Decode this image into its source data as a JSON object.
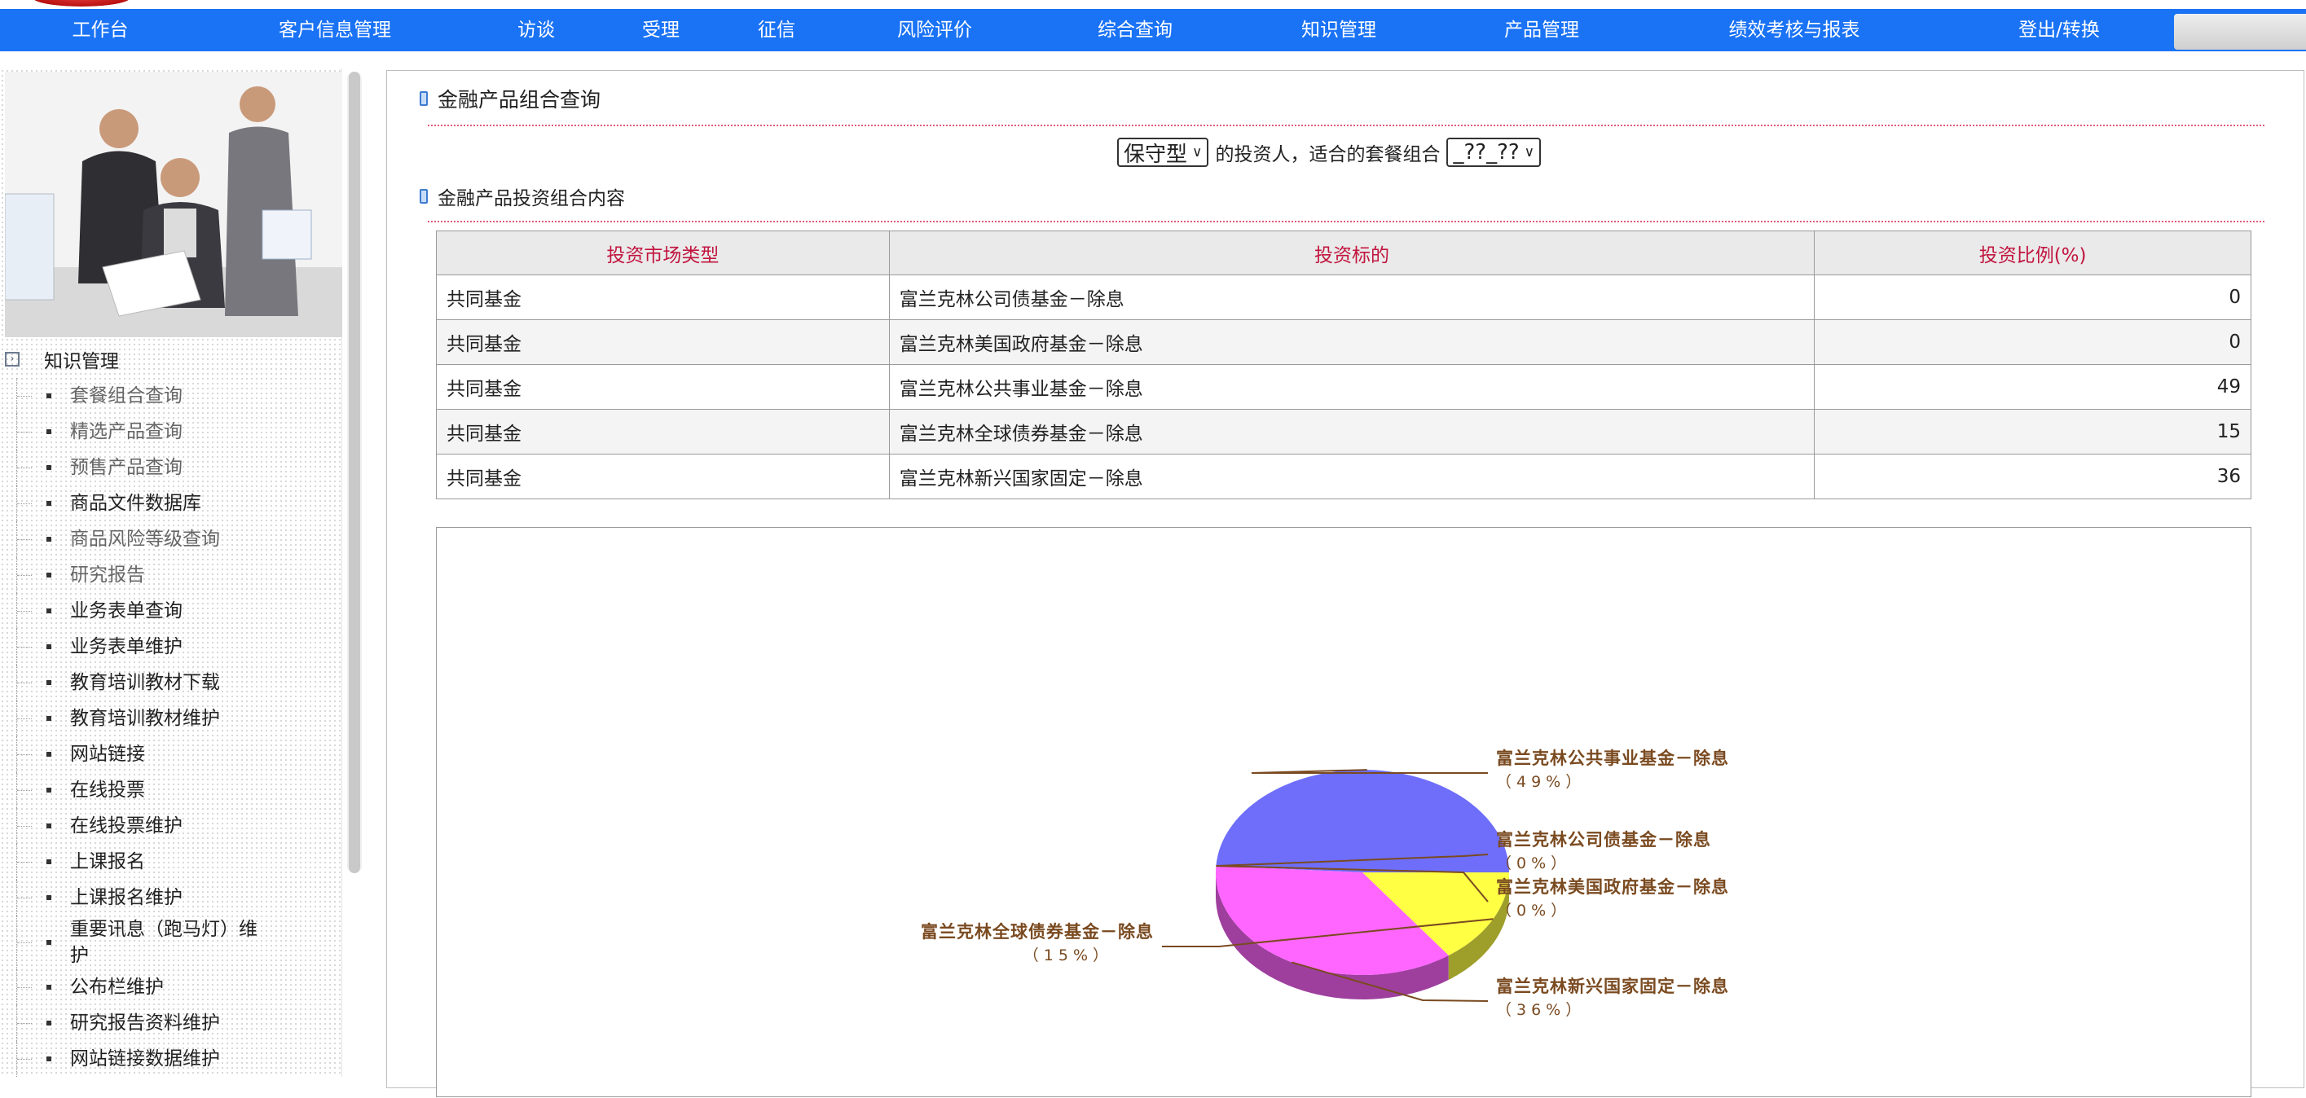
{
  "nav": {
    "items": [
      "工作台",
      "客户信息管理",
      "访谈",
      "受理",
      "征信",
      "风险评价",
      "综合查询",
      "知识管理",
      "产品管理",
      "绩效考核与报表",
      "登出/转换"
    ]
  },
  "sidebar": {
    "section_title": "知识管理",
    "items": [
      {
        "label": "套餐组合查询"
      },
      {
        "label": "精选产品查询"
      },
      {
        "label": "预售产品查询"
      },
      {
        "label": "商品文件数据库"
      },
      {
        "label": "商品风险等级查询"
      },
      {
        "label": "研究报告"
      },
      {
        "label": "业务表单查询"
      },
      {
        "label": "业务表单维护"
      },
      {
        "label": "教育培训教材下载"
      },
      {
        "label": "教育培训教材维护"
      },
      {
        "label": "网站链接"
      },
      {
        "label": "在线投票"
      },
      {
        "label": "在线投票维护"
      },
      {
        "label": "上课报名"
      },
      {
        "label": "上课报名维护"
      },
      {
        "label": "重要讯息（跑马灯）维护"
      },
      {
        "label": "公布栏维护"
      },
      {
        "label": "研究报告资料维护"
      },
      {
        "label": "网站链接数据维护"
      }
    ]
  },
  "main": {
    "title": "金融产品组合查询",
    "filter": {
      "risk_type": "保守型",
      "middle_text": "的投资人，适合的套餐组合",
      "combo": "_??_??"
    },
    "subtitle": "金融产品投资组合内容",
    "table": {
      "headers": [
        "投资市场类型",
        "投资标的",
        "投资比例(%)"
      ],
      "rows": [
        [
          "共同基金",
          "富兰克林公司债基金－除息",
          "0"
        ],
        [
          "共同基金",
          "富兰克林美国政府基金－除息",
          "0"
        ],
        [
          "共同基金",
          "富兰克林公共事业基金－除息",
          "49"
        ],
        [
          "共同基金",
          "富兰克林全球债券基金－除息",
          "15"
        ],
        [
          "共同基金",
          "富兰克林新兴国家固定－除息",
          "36"
        ]
      ]
    }
  },
  "chart_data": {
    "type": "pie",
    "title": "",
    "slices": [
      {
        "label": "富兰克林公共事业基金－除息",
        "value": 49,
        "pct_label": "（49%）",
        "color": "#6e6efb"
      },
      {
        "label": "富兰克林公司债基金－除息",
        "value": 0,
        "pct_label": "（0%）",
        "color": "#6e6efb"
      },
      {
        "label": "富兰克林美国政府基金－除息",
        "value": 0,
        "pct_label": "（0%）",
        "color": "#6e6efb"
      },
      {
        "label": "富兰克林新兴国家固定－除息",
        "value": 36,
        "pct_label": "（36%）",
        "color": "#ff66ff"
      },
      {
        "label": "富兰克林全球债券基金－除息",
        "value": 15,
        "pct_label": "（15%）",
        "color": "#ffff44"
      }
    ],
    "style": "3d"
  }
}
